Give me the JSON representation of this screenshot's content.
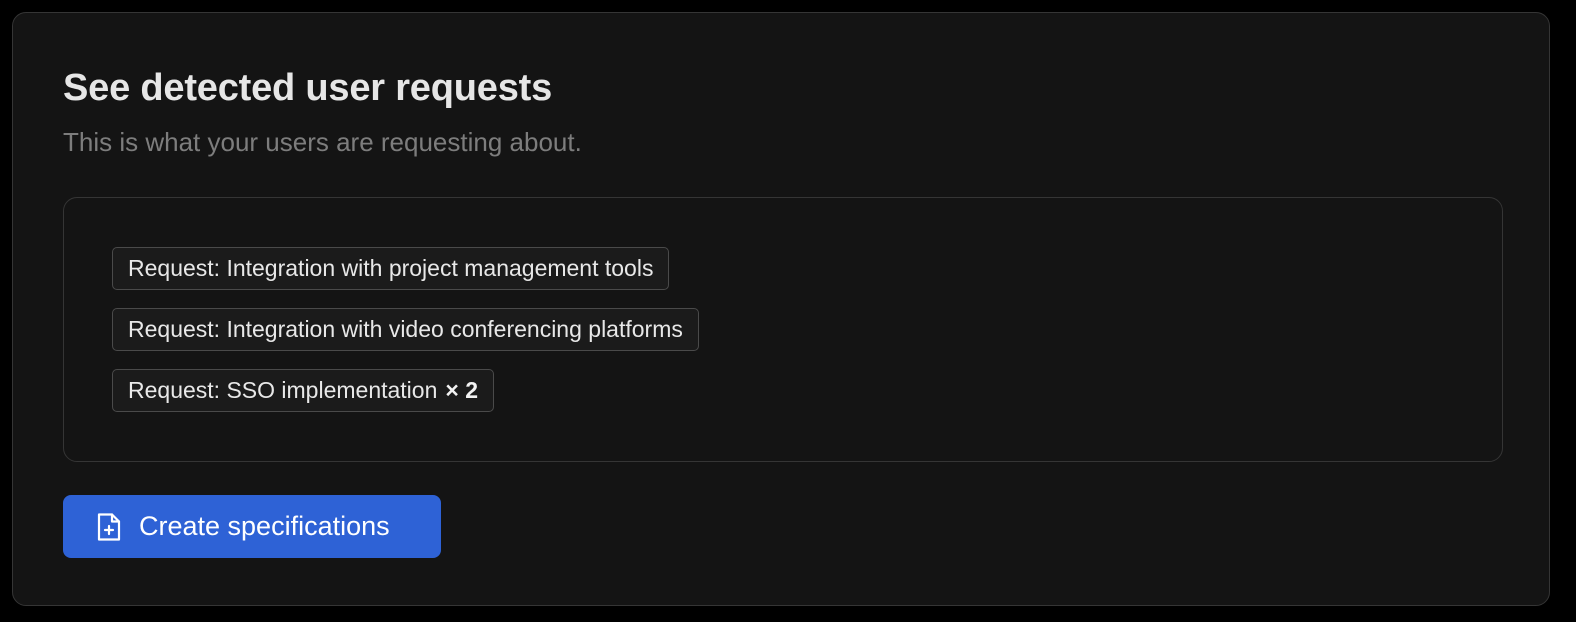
{
  "colors": {
    "background": "#000000",
    "card": "#141414",
    "border": "#353535",
    "tag_border": "#4a4a4a",
    "title": "#e6e6e6",
    "subtitle": "#7d7d7d",
    "accent": "#2e62d6"
  },
  "header": {
    "title": "See detected user requests",
    "subtitle": "This is what your users are requesting about."
  },
  "requests": [
    {
      "label": "Request: Integration with project management tools",
      "count": ""
    },
    {
      "label": "Request: Integration with video conferencing platforms",
      "count": ""
    },
    {
      "label": "Request: SSO implementation",
      "count": "× 2"
    }
  ],
  "actions": {
    "create_label": "Create specifications",
    "create_icon": "file-plus-icon"
  }
}
